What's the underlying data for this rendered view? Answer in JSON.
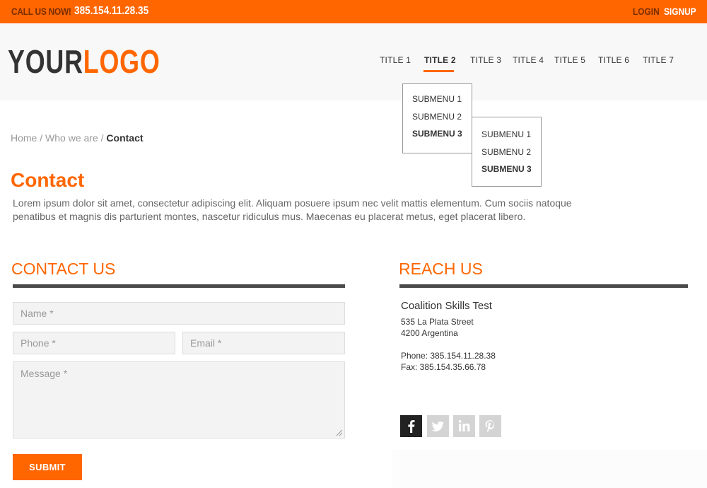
{
  "topbar": {
    "call_label": "CALL US NOW!",
    "phone": "385.154.11.28.35",
    "login": "LOGIN",
    "signup": "SIGNUP"
  },
  "logo": {
    "part1": "YOUR",
    "part2": "LOGO"
  },
  "nav": {
    "items": [
      "TITLE 1",
      "TITLE 2",
      "TITLE 3",
      "TITLE 4",
      "TITLE 5",
      "TITLE 6",
      "TITLE 7"
    ],
    "active_index": 1
  },
  "submenu": {
    "level1": [
      "SUBMENU 1",
      "SUBMENU 2",
      "SUBMENU 3"
    ],
    "level2": [
      "SUBMENU 1",
      "SUBMENU 2",
      "SUBMENU 3"
    ]
  },
  "breadcrumb": {
    "home": "Home",
    "who": "Who we are",
    "current": "Contact",
    "separator": "/"
  },
  "page": {
    "title": "Contact",
    "intro": "Lorem ipsum dolor sit amet, consectetur adipiscing elit. Aliquam posuere ipsum nec velit mattis elementum. Cum sociis natoque penatibus et magnis dis parturient montes, nascetur ridiculus mus. Maecenas eu placerat metus, eget placerat libero."
  },
  "contact_form": {
    "title": "CONTACT US",
    "name_placeholder": "Name *",
    "phone_placeholder": "Phone *",
    "email_placeholder": "Email *",
    "message_placeholder": "Message *",
    "submit_label": "SUBMIT"
  },
  "reach": {
    "title": "REACH US",
    "org": "Coalition Skills Test",
    "street": "535 La Plata Street",
    "city": "4200 Argentina",
    "phone": "Phone: 385.154.11.28.38",
    "fax": "Fax: 385.154.35.66.78",
    "social": [
      "facebook-icon",
      "twitter-icon",
      "linkedin-icon",
      "pinterest-icon"
    ]
  },
  "colors": {
    "accent": "#ff6600",
    "dark": "#333333",
    "rule": "#4a4a4a",
    "field_bg": "#f3f3f3"
  }
}
